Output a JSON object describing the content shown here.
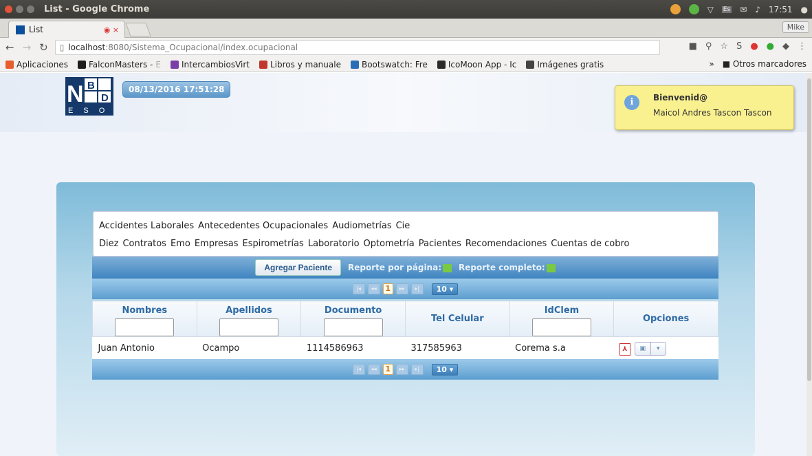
{
  "window": {
    "title": "List - Google Chrome",
    "clock": "17:51",
    "user_badge": "Mike"
  },
  "tab": {
    "label": "List"
  },
  "address": {
    "host": "localhost",
    "rest": ":8080/Sistema_Ocupacional/index.ocupacional"
  },
  "bookmarks": {
    "items": [
      {
        "label": "Aplicaciones",
        "color": "#e65d2e"
      },
      {
        "label": "FalconMasters - ",
        "fade": "E",
        "color": "#1e1e1e"
      },
      {
        "label": "IntercambiosVirt",
        "fade": "",
        "color": "#7a3fa6"
      },
      {
        "label": "Libros y manuale",
        "fade": "",
        "color": "#c0392b"
      },
      {
        "label": "Bootswatch: Fre",
        "fade": "",
        "color": "#2a6fb5"
      },
      {
        "label": "IcoMoon App - Ic",
        "fade": "",
        "color": "#2a2a2a"
      },
      {
        "label": "Imágenes gratis",
        "fade": "",
        "color": "#444"
      }
    ],
    "more": "»",
    "other": "Otros marcadores"
  },
  "header": {
    "datetime": "08/13/2016 17:51:28",
    "logo": {
      "l1": "B",
      "l2": "D",
      "l3": "N",
      "l4": "E S O"
    }
  },
  "welcome": {
    "title": "Bienvenid@",
    "user": "Maicol Andres Tascon Tascon"
  },
  "menu": {
    "items": [
      "Accidentes Laborales",
      "Antecedentes Ocupacionales",
      "Audiometrías",
      "Cie Diez",
      "Contratos",
      "Emo",
      "Empresas",
      "Espirometrías",
      "Laboratorio",
      "Optometría",
      "Pacientes",
      "Recomendaciones",
      "Cuentas de cobro"
    ]
  },
  "toolbar": {
    "add_label": "Agregar Paciente",
    "report_page": "Reporte por página:",
    "report_full": "Reporte completo:"
  },
  "pager": {
    "current": "1",
    "per_page": "10 ▾"
  },
  "table": {
    "columns": [
      "Nombres",
      "Apellidos",
      "Documento",
      "Tel Celular",
      "IdClem",
      "Opciones"
    ],
    "rows": [
      [
        "Juan Antonio",
        "Ocampo",
        "1114586963",
        "317585963",
        "Corema s.a"
      ]
    ]
  }
}
